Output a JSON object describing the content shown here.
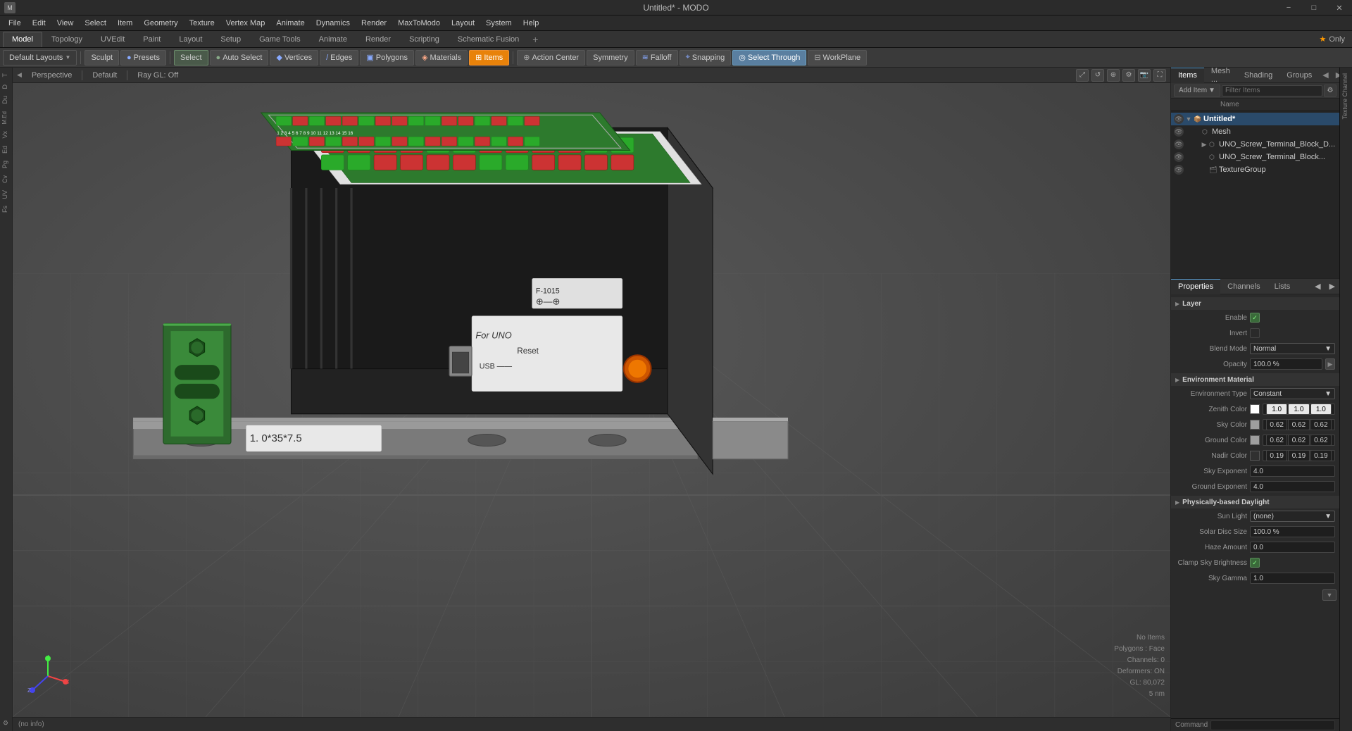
{
  "window": {
    "title": "Untitled* - MODO",
    "min_label": "−",
    "max_label": "□",
    "close_label": "✕"
  },
  "menubar": {
    "items": [
      "File",
      "Edit",
      "View",
      "Select",
      "Item",
      "Geometry",
      "Texture",
      "Vertex Map",
      "Animate",
      "Dynamics",
      "Render",
      "MaxToModo",
      "Layout",
      "System",
      "Help"
    ]
  },
  "tabs": {
    "items": [
      "Model",
      "Topology",
      "UVEdit",
      "Paint",
      "Layout",
      "Setup",
      "Game Tools",
      "Animate",
      "Render",
      "Scripting",
      "Schematic Fusion"
    ],
    "active": "Model",
    "plus_label": "+",
    "only_label": "Only",
    "star": "★"
  },
  "toolbar": {
    "sculpt_label": "Sculpt",
    "presets_label": "Presets",
    "auto_select_label": "Auto Select",
    "vertices_label": "Vertices",
    "edges_label": "Edges",
    "polygons_label": "Polygons",
    "materials_label": "Materials",
    "items_label": "Items",
    "action_center_label": "Action Center",
    "symmetry_label": "Symmetry",
    "falloff_label": "Falloff",
    "snapping_label": "Snapping",
    "select_through_label": "Select Through",
    "workplane_label": "WorkPlane",
    "select_label": "Select"
  },
  "viewport": {
    "perspective_label": "Perspective",
    "default_label": "Default",
    "ray_gl_label": "Ray GL: Off",
    "status_label": "(no info)",
    "no_items_label": "No Items",
    "polygons_label": "Polygons : Face",
    "channels_label": "Channels: 0",
    "deformers_label": "Deformers: ON",
    "gl_label": "GL: 80,072",
    "nm_label": "5 nm"
  },
  "items_panel": {
    "tabs": [
      "Items",
      "Mesh ...",
      "Shading",
      "Groups"
    ],
    "active_tab": "Items",
    "add_item_label": "Add Item",
    "filter_label": "Filter Items",
    "name_col": "Name",
    "tree": [
      {
        "id": "untitled",
        "label": "Untitled*",
        "level": 0,
        "expand": "▼",
        "icon": "📦",
        "selected": true
      },
      {
        "id": "mesh",
        "label": "Mesh",
        "level": 1,
        "expand": "",
        "icon": "⬡",
        "selected": false
      },
      {
        "id": "uno_block_d",
        "label": "UNO_Screw_Terminal_Block_D...",
        "level": 2,
        "expand": "▶",
        "icon": "⬡",
        "selected": false
      },
      {
        "id": "uno_block",
        "label": "UNO_Screw_Terminal_Block...",
        "level": 2,
        "expand": "",
        "icon": "⬡",
        "selected": false
      },
      {
        "id": "texture_group",
        "label": "TextureGroup",
        "level": 2,
        "expand": "",
        "icon": "🗂",
        "selected": false
      }
    ]
  },
  "properties_panel": {
    "tabs": [
      "Properties",
      "Channels",
      "Lists"
    ],
    "active_tab": "Properties",
    "sections": {
      "layer": {
        "title": "Layer",
        "enable_label": "Enable",
        "enable_checked": true,
        "invert_label": "Invert",
        "invert_checked": false,
        "blend_mode_label": "Blend Mode",
        "blend_mode_value": "Normal",
        "opacity_label": "Opacity",
        "opacity_value": "100.0 %"
      },
      "environment_material": {
        "title": "Environment Material",
        "env_type_label": "Environment Type",
        "env_type_value": "Constant",
        "zenith_color_label": "Zenith Color",
        "zenith_r": "1.0",
        "zenith_g": "1.0",
        "zenith_b": "1.0",
        "sky_color_label": "Sky Color",
        "sky_r": "0.62",
        "sky_g": "0.62",
        "sky_b": "0.62",
        "ground_color_label": "Ground Color",
        "ground_r": "0.62",
        "ground_g": "0.62",
        "ground_b": "0.62",
        "nadir_color_label": "Nadir Color",
        "nadir_r": "0.19",
        "nadir_g": "0.19",
        "nadir_b": "0.19",
        "sky_exp_label": "Sky Exponent",
        "sky_exp_value": "4.0",
        "ground_exp_label": "Ground Exponent",
        "ground_exp_value": "4.0"
      },
      "daylight": {
        "title": "Physically-based Daylight",
        "sun_light_label": "Sun Light",
        "sun_light_value": "(none)",
        "solar_disc_label": "Solar Disc Size",
        "solar_disc_value": "100.0 %",
        "haze_amount_label": "Haze Amount",
        "haze_amount_value": "0.0",
        "clamp_label": "Clamp Sky Brightness",
        "clamp_checked": true,
        "sky_gamma_label": "Sky Gamma",
        "sky_gamma_value": "1.0"
      }
    }
  },
  "texture_sidebar": {
    "label": "Texture Channel"
  },
  "command_bar": {
    "label": "Command"
  }
}
